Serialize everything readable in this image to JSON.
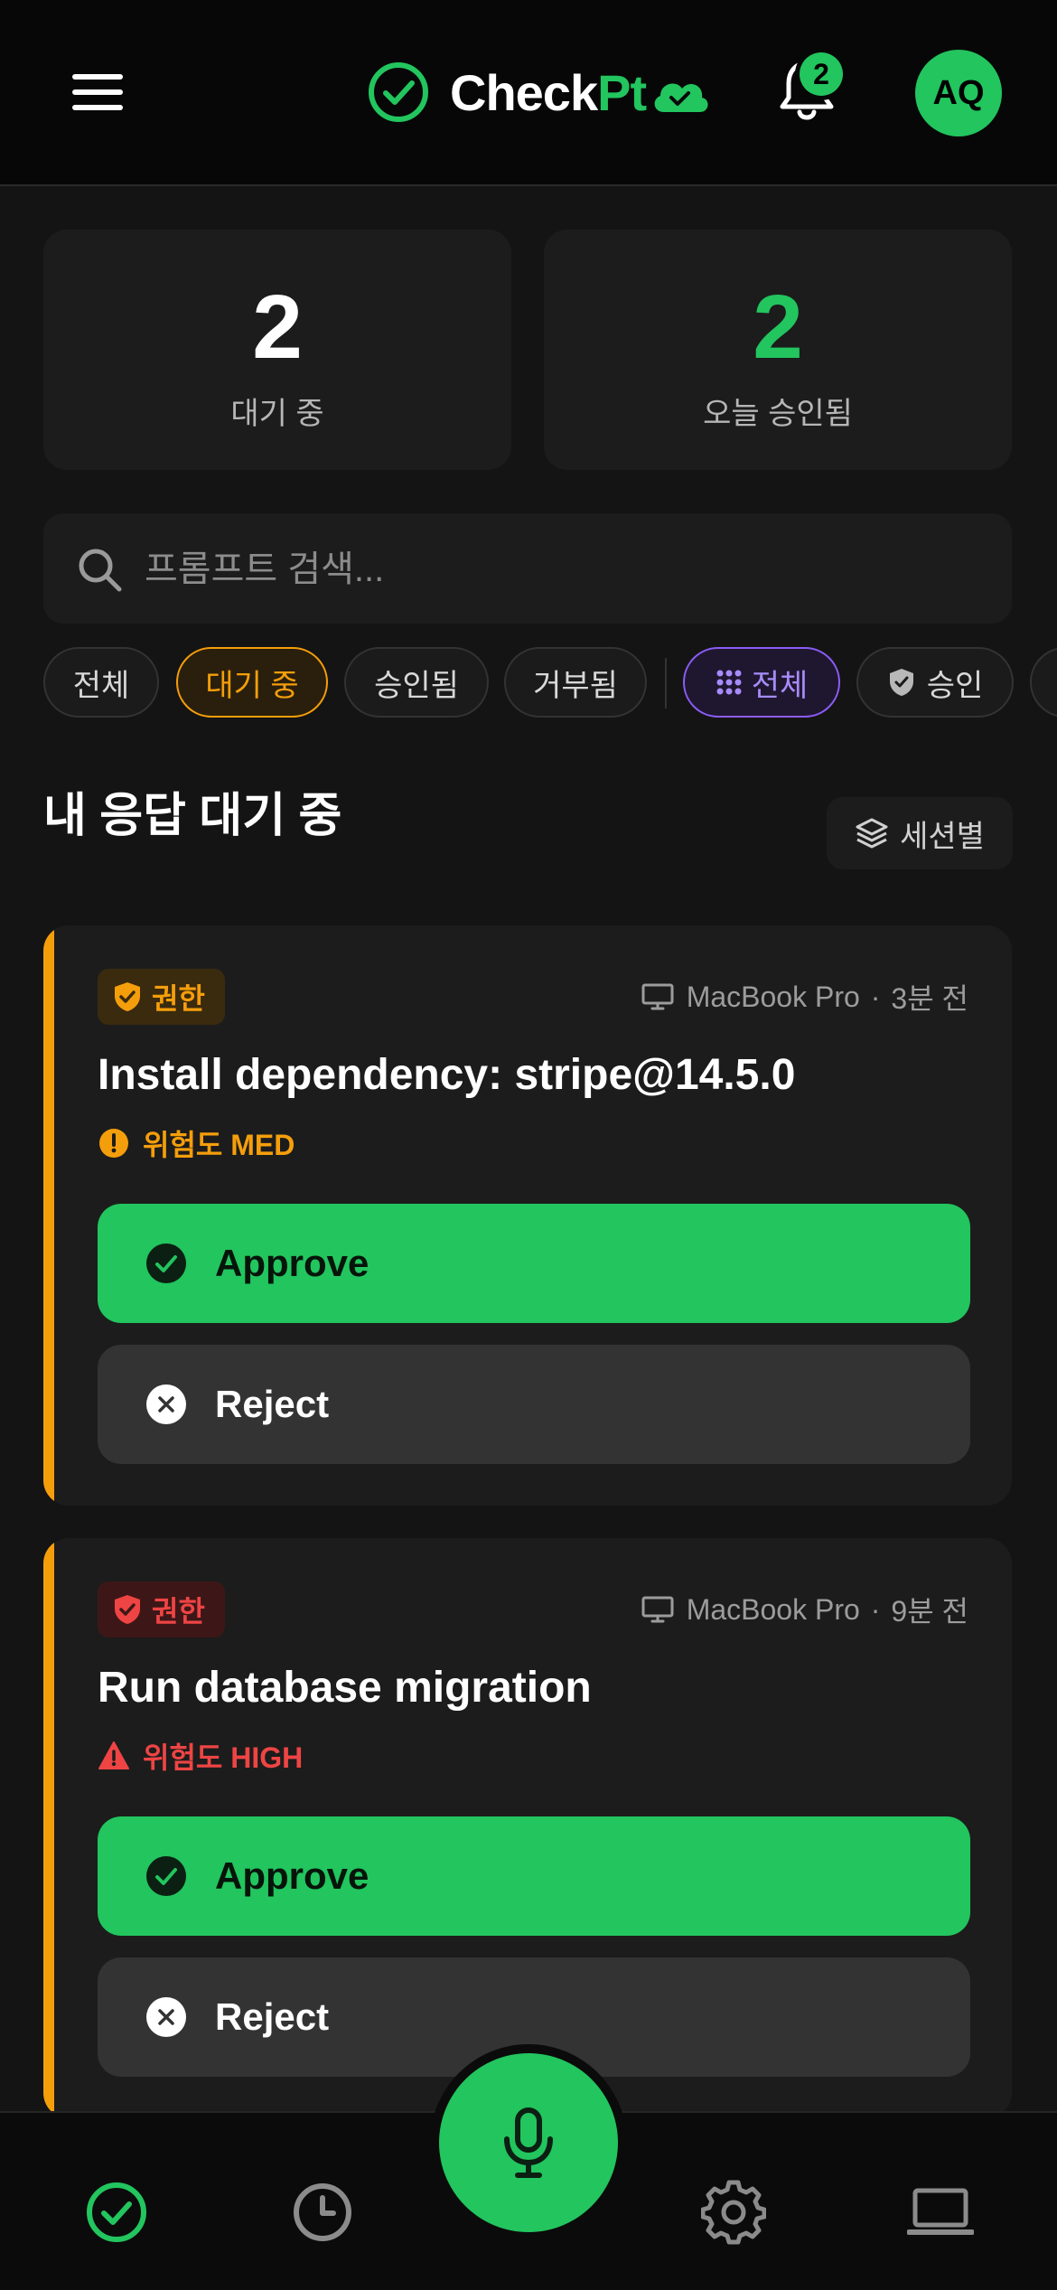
{
  "header": {
    "logo_text_main": "Check",
    "logo_text_accent": "Pt",
    "notification_count": "2",
    "avatar_initials": "AQ"
  },
  "stats": [
    {
      "value": "2",
      "label": "대기 중",
      "color": "#ffffff"
    },
    {
      "value": "2",
      "label": "오늘 승인됨",
      "color": "#22c55e"
    }
  ],
  "search": {
    "placeholder": "프롬프트 검색..."
  },
  "filters": {
    "status": [
      "전체",
      "대기 중",
      "승인됨",
      "거부됨"
    ],
    "active_status": "대기 중",
    "type": [
      "전체",
      "승인"
    ],
    "active_type": "전체"
  },
  "section": {
    "title": "내 응답 대기 중",
    "group_button": "세션별"
  },
  "cards": [
    {
      "badge": "권한",
      "badge_color": "orange",
      "device": "MacBook Pro",
      "time": "3분 전",
      "title": "Install dependency: stripe@14.5.0",
      "risk": "위험도 MED",
      "approve_label": "Approve",
      "reject_label": "Reject"
    },
    {
      "badge": "권한",
      "badge_color": "red",
      "device": "MacBook Pro",
      "time": "9분 전",
      "title": "Run database migration",
      "risk": "위험도 HIGH",
      "approve_label": "Approve",
      "reject_label": "Reject"
    }
  ],
  "bottom_nav": {
    "items": [
      {
        "icon": "check-circle-icon",
        "active": true
      },
      {
        "icon": "clock-icon",
        "active": false
      },
      {
        "icon": "mic-icon",
        "active": false
      },
      {
        "icon": "gear-icon",
        "active": false
      },
      {
        "icon": "laptop-icon",
        "active": false
      }
    ]
  },
  "colors": {
    "accent": "#22c55e",
    "warning": "#f59e0b",
    "danger": "#ef4444",
    "purple": "#8b5cf6"
  }
}
